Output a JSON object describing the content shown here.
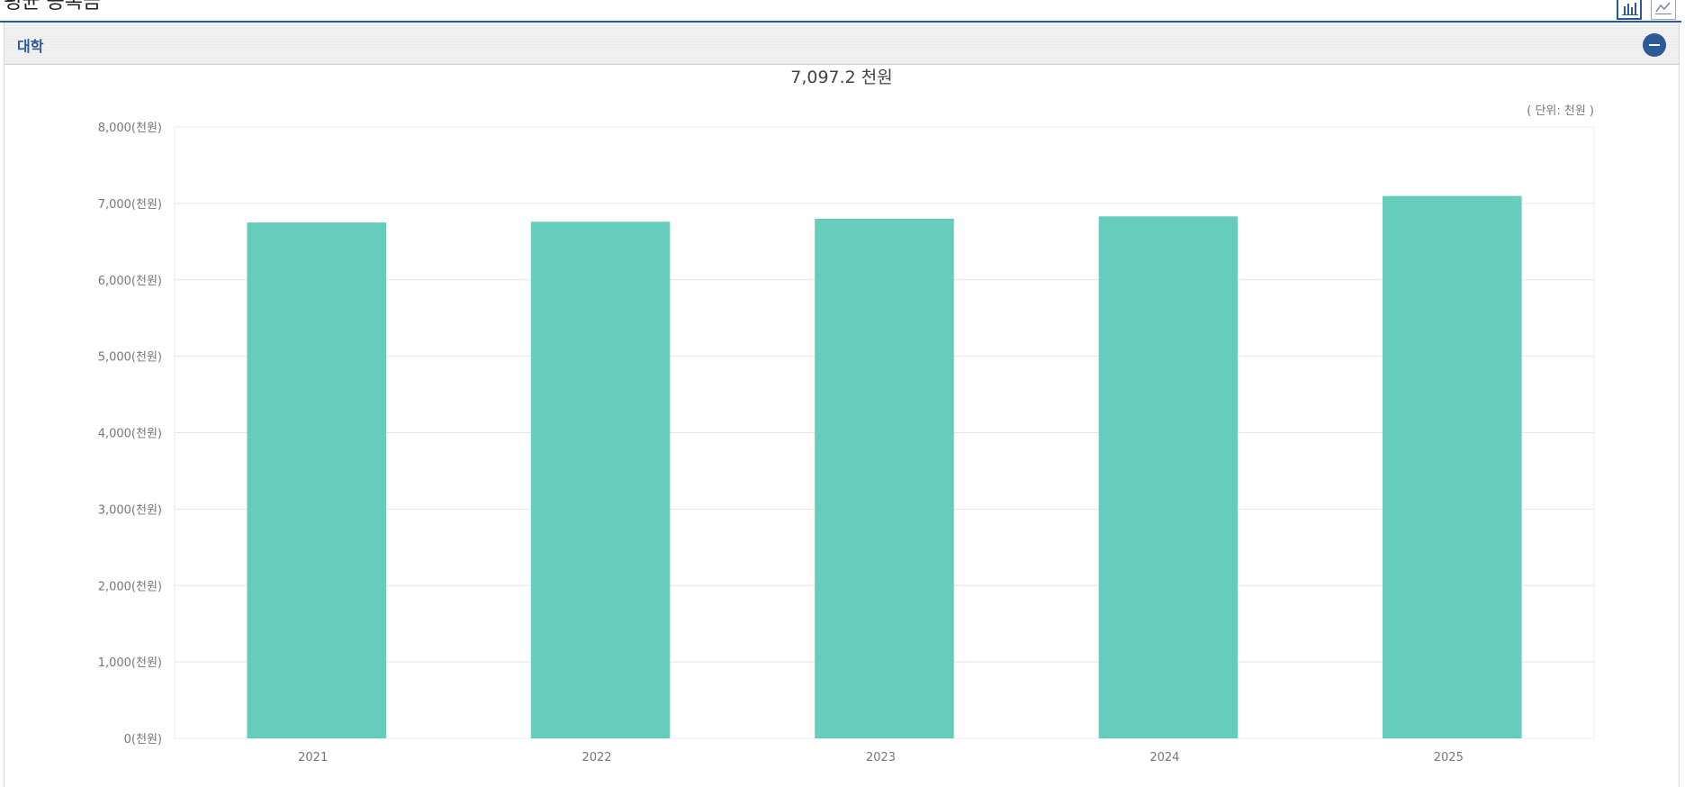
{
  "page": {
    "heading": "평균 등록금"
  },
  "view_toggle": {
    "bar_icon": "bar-chart-icon",
    "line_icon": "line-chart-icon",
    "active": "bar"
  },
  "section": {
    "title": "대학",
    "collapse_icon": "minus-circle-icon"
  },
  "colors": {
    "accent": "#2a5a97",
    "bar": "#66ccbb"
  },
  "chart_data": {
    "type": "bar",
    "title": "7,097.2 천원",
    "unit_note": "( 단위: 천원 )",
    "categories": [
      "2021",
      "2022",
      "2023",
      "2024",
      "2025"
    ],
    "series": [
      {
        "values": [
          6750,
          6760,
          6800,
          6830,
          7097.2
        ]
      }
    ],
    "ylim": [
      0,
      8000
    ],
    "yticks": [
      "0(천원)",
      "1,000(천원)",
      "2,000(천원)",
      "3,000(천원)",
      "4,000(천원)",
      "5,000(천원)",
      "6,000(천원)",
      "7,000(천원)",
      "8,000(천원)"
    ],
    "grid": true,
    "legend": "none"
  }
}
